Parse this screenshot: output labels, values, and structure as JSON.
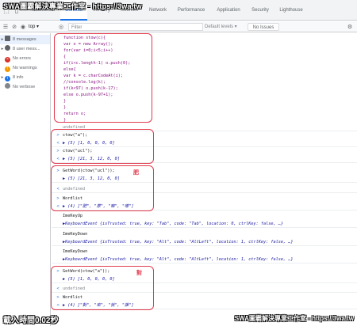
{
  "watermark_top": "SWA圖霸解決專業工作室 - https://3wa.tw",
  "tabs": [
    {
      "label": "Elements",
      "active": false
    },
    {
      "label": "Console",
      "active": true
    },
    {
      "label": "Memory",
      "active": false
    },
    {
      "label": "Sources",
      "active": false
    },
    {
      "label": "Network",
      "active": false
    },
    {
      "label": "Performance",
      "active": false
    },
    {
      "label": "Application",
      "active": false
    },
    {
      "label": "Security",
      "active": false
    },
    {
      "label": "Lighthouse",
      "active": false
    }
  ],
  "toolbar": {
    "context": "top ▾",
    "filter_placeholder": "Filter",
    "levels": "Default levels ▾",
    "issues": "No Issues"
  },
  "sidebar": {
    "items": [
      {
        "icon": "list-icon",
        "label": "8 messages",
        "selected": true
      },
      {
        "icon": "user-icon",
        "label": "8 user mess...",
        "selected": false
      },
      {
        "icon": "error-icon",
        "label": "No errors",
        "selected": false
      },
      {
        "icon": "warning-icon",
        "label": "No warnings",
        "selected": false
      },
      {
        "icon": "info-icon",
        "label": "8 info",
        "selected": false
      },
      {
        "icon": "verbose-icon",
        "label": "No verbose",
        "selected": false
      }
    ]
  },
  "code": [
    "function stow(c){",
    "  var o = new Array();",
    "  for(var i=0;i<5;i++)",
    "  {",
    "    if(i<c.length-1) o.push(0);",
    "    else{",
    "    var k = c.charCodeAt(i);",
    "    //console.log(k);",
    "    if(k<97) o.push(k-17);",
    "    else o.push(k-97+1);",
    "    }",
    "  }",
    "  return o;",
    "}"
  ],
  "console_lines": [
    {
      "gutter": "",
      "text": "undefined",
      "style": "undef"
    },
    {
      "gutter": ">",
      "text": "ctow(\"a\");",
      "style": "in"
    },
    {
      "gutter": "<",
      "text": "▶ (5) [1, 0, 0, 0, 0]",
      "style": "out"
    },
    {
      "gutter": ">",
      "text": "ctow(\"ucl\");",
      "style": "in"
    },
    {
      "gutter": "<",
      "text": "▶ (5) [21, 3, 12, 0, 0]",
      "style": "out"
    },
    {
      "gutter": ">",
      "text": "GetWord(ctow(\"ucl\"));",
      "style": "in"
    },
    {
      "gutter": "",
      "text": "▶ (5) [21, 3, 12, 0, 0]",
      "style": "out"
    },
    {
      "gutter": "<",
      "text": "undefined",
      "style": "undef"
    },
    {
      "gutter": ">",
      "text": "Wordlist",
      "style": "in"
    },
    {
      "gutter": "<",
      "text": "▶ (4) [\"肥\", \"厚\", \"嘛\", \"哪\"]",
      "style": "out"
    },
    {
      "gutter": "",
      "text": "ImeKeyUp",
      "style": "plain"
    },
    {
      "gutter": "",
      "text": "▶KeyboardEvent {isTrusted: true, key: \"Tab\", code: \"Tab\", location: 0, ctrlKey: false, …}",
      "style": "out"
    },
    {
      "gutter": "",
      "text": "ImeKeyDown",
      "style": "plain"
    },
    {
      "gutter": "",
      "text": "▶KeyboardEvent {isTrusted: true, key: \"Alt\", code: \"AltLeft\", location: 1, ctrlKey: false, …}",
      "style": "out"
    },
    {
      "gutter": "",
      "text": "ImeKeyDown",
      "style": "plain"
    },
    {
      "gutter": "",
      "text": "▶KeyboardEvent {isTrusted: true, key: \"Alt\", code: \"AltLeft\", location: 1, ctrlKey: false, …}",
      "style": "out"
    },
    {
      "gutter": ">",
      "text": "GetWord(ctow(\"a\"));",
      "style": "in"
    },
    {
      "gutter": "",
      "text": "▶ (5) [1, 0, 0, 0, 0]",
      "style": "out"
    },
    {
      "gutter": "<",
      "text": "undefined",
      "style": "undef"
    },
    {
      "gutter": ">",
      "text": "Wordlist",
      "style": "in"
    },
    {
      "gutter": "<",
      "text": "▶ (4) [\"對\", \"來\", \"就\", \"誰\"]",
      "style": "out"
    }
  ],
  "annotations": {
    "label_1": "肥",
    "label_2": "對"
  },
  "watermark_bottom_left": "載入時間0.02秒",
  "watermark_bottom_right": "SWA圖霸解決專業工作室 - https://3wa.tw",
  "colors": {
    "accent": "#1a73e8",
    "highlight_box": "#e23b4e",
    "output_text": "#1a1aa6"
  }
}
